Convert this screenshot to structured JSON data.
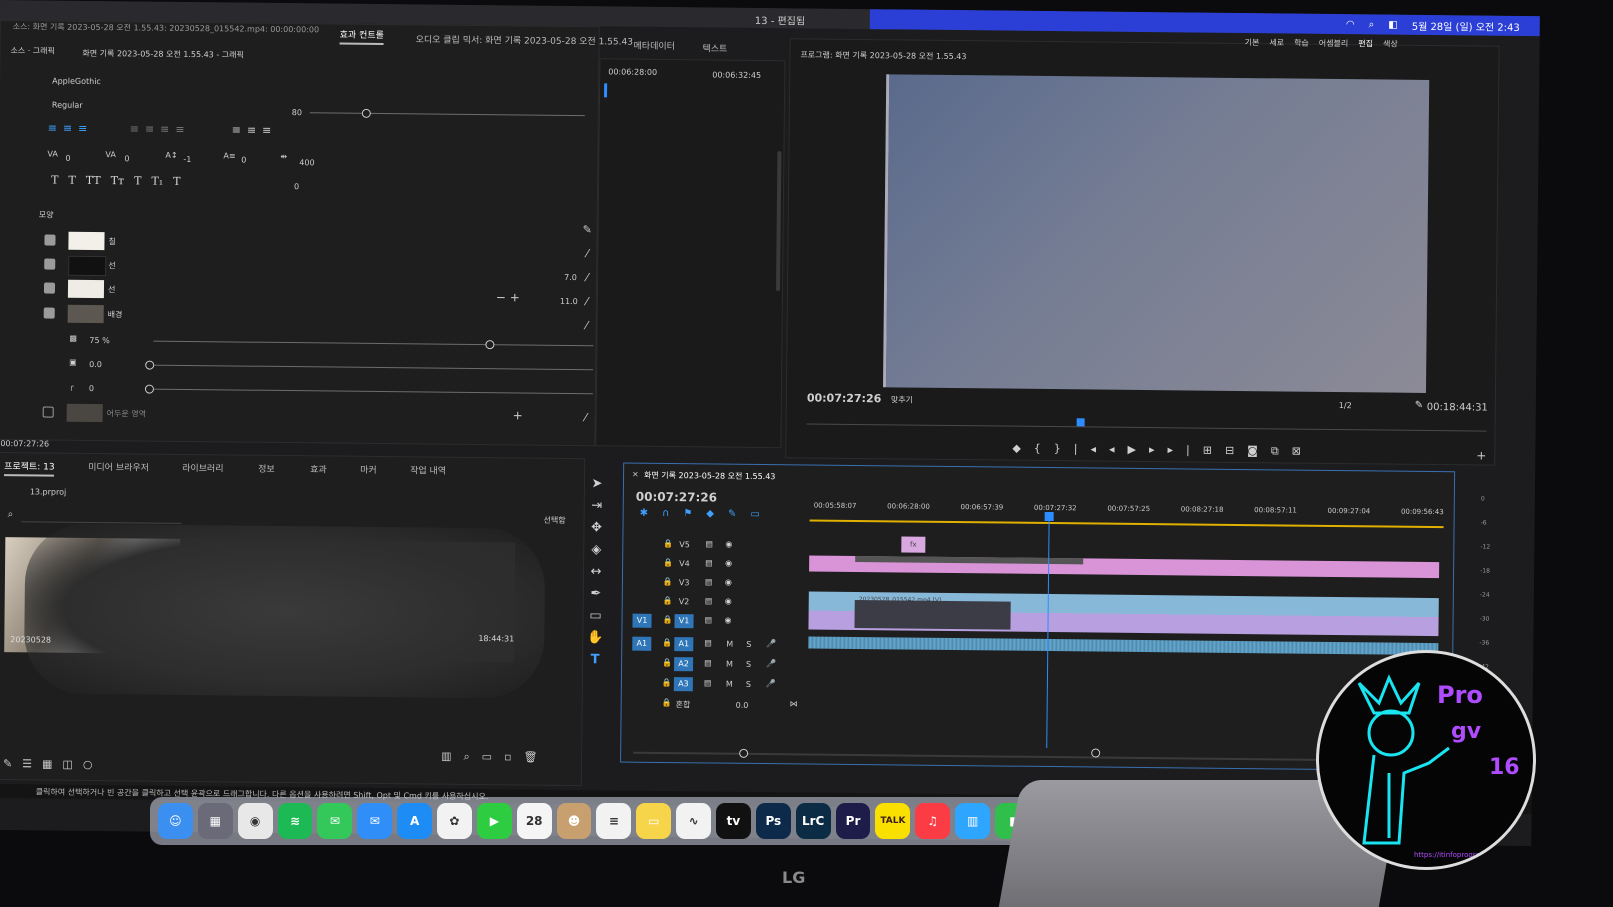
{
  "menubar": {
    "title": "13 - 편집됨",
    "datetime": "5월 28일 (일) 오전 2:43"
  },
  "source_panel": {
    "top_line": "소스: 화면 기록 2023-05-28 오전 1.55.43: 20230528_015542.mp4: 00:00:00:00",
    "selector": "소스 · 그래픽",
    "clip_label": "화면 기록 2023-05-28 오전 1.55.43 - 그래픽"
  },
  "tabs_top": [
    "효과 컨트롤",
    "오디오 클립 믹서: 화면 기록 2023-05-28 오전 1.55.43",
    "메타데이터",
    "텍스트"
  ],
  "effect_controls": {
    "font": "AppleGothic",
    "style": "Regular",
    "font_size": "80",
    "tracking": "0",
    "kerning": "0",
    "baseline": "-1",
    "leading": "0",
    "tsume": "400",
    "indent": "0",
    "type_buttons": [
      "T",
      "T",
      "TT",
      "Tт",
      "T",
      "T₁",
      "T"
    ],
    "timecode_a": "00:06:28:00",
    "timecode_b": "00:06:32:45",
    "appearance_title": "모양",
    "fill_label": "칠",
    "stroke1_label": "선",
    "stroke1_value": "7.0",
    "stroke2_label": "선",
    "stroke2_value": "11.0",
    "bg_label": "배경",
    "opacity": "75 %",
    "size_value": "0.0",
    "corner_value": "0",
    "shadow_label": "어두운 영역",
    "current_time": "00:07:27:26"
  },
  "program": {
    "title": "프로그램: 화면 기록 2023-05-28 오전 1.55.43",
    "timecode": "00:07:27:26",
    "fit": "맞추기",
    "res": "1/2",
    "duration": "00:18:44:31",
    "workspaces": [
      "기본",
      "세로",
      "학습",
      "어셈블리",
      "편집",
      "색상"
    ]
  },
  "project": {
    "tabs": [
      "프로젝트: 13",
      "미디어 브라우저",
      "라이브러리",
      "정보",
      "효과",
      "마커",
      "작업 내역"
    ],
    "file": "13.prproj",
    "selected": "선택함",
    "thumb_name": "20230528",
    "thumb_dur": "18:44:31"
  },
  "timeline": {
    "title": "화면 기록 2023-05-28 오전 1.55.43",
    "timecode": "00:07:27:26",
    "ruler": [
      "00:05:58:07",
      "00:06:28:00",
      "00:06:57:39",
      "00:07:27:32",
      "00:07:57:25",
      "00:08:27:18",
      "00:08:57:11",
      "00:09:27:04",
      "00:09:56:43"
    ],
    "video_tracks": [
      "V5",
      "V4",
      "V3",
      "V2",
      "V1"
    ],
    "audio_tracks": [
      "A1",
      "A2",
      "A3"
    ],
    "mix_label": "혼합",
    "mix_value": "0.0",
    "fx_badge": "fx",
    "clip_name": "20230528_015542.mp4 [V]"
  },
  "meters": [
    "0",
    "-6",
    "-12",
    "-18",
    "-24",
    "-30",
    "-36",
    "-42"
  ],
  "status_bar": "클릭하여 선택하거나 빈 공간을 클릭하고 선택 윤곽으로 드래그합니다. 다른 옵션을 사용하려면 Shift, Opt 및 Cmd 키를 사용하십시오.",
  "dock": [
    {
      "name": "finder",
      "label": "☺",
      "color": "#3b8ff0"
    },
    {
      "name": "launchpad",
      "label": "▦",
      "color": "#6a6a78"
    },
    {
      "name": "chrome",
      "label": "◉",
      "color": "#e8e8e8"
    },
    {
      "name": "spotify",
      "label": "≋",
      "color": "#1db954"
    },
    {
      "name": "messages",
      "label": "✉",
      "color": "#34c759"
    },
    {
      "name": "mail",
      "label": "✉",
      "color": "#2f8ef7"
    },
    {
      "name": "appstore",
      "label": "A",
      "color": "#1d8df5"
    },
    {
      "name": "photos",
      "label": "✿",
      "color": "#f2f2f2"
    },
    {
      "name": "facetime",
      "label": "▶",
      "color": "#2ecc40"
    },
    {
      "name": "calendar",
      "label": "28",
      "color": "#f5f5f5"
    },
    {
      "name": "contacts",
      "label": "☻",
      "color": "#c8a070"
    },
    {
      "name": "reminders",
      "label": "≡",
      "color": "#f2f2f2"
    },
    {
      "name": "notes",
      "label": "▭",
      "color": "#f7d54a"
    },
    {
      "name": "freeform",
      "label": "∿",
      "color": "#f2f2f2"
    },
    {
      "name": "appletv",
      "label": "tv",
      "color": "#111111"
    },
    {
      "name": "photoshop",
      "label": "Ps",
      "color": "#0d2a4a"
    },
    {
      "name": "lightroom",
      "label": "LrC",
      "color": "#0c2b45"
    },
    {
      "name": "premiere",
      "label": "Pr",
      "color": "#1e1d4a"
    },
    {
      "name": "kakaotalk",
      "label": "TALK",
      "color": "#f9e000"
    },
    {
      "name": "music",
      "label": "♫",
      "color": "#fc3c44"
    },
    {
      "name": "keynote",
      "label": "▥",
      "color": "#2ea6ff"
    },
    {
      "name": "numbers",
      "label": "▮",
      "color": "#2fbf4a"
    }
  ],
  "logo": {
    "line1": "Pro",
    "line2": "gv",
    "line3": "16",
    "url": "https://itinfoprogramgv.tistory.com"
  },
  "monitor_brand": "LG"
}
